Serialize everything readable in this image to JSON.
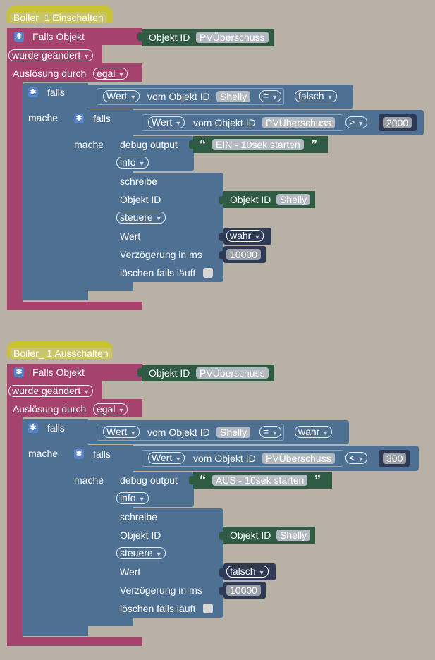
{
  "groups": [
    {
      "name": "Boiler_1 Einschalten",
      "trigger_label": "Falls Objekt",
      "trigger_object_prefix": "Objekt ID",
      "trigger_object_id": "PVÜberschuss",
      "change_option": "wurde geändert",
      "trigger_by_label": "Auslösung durch",
      "trigger_by_value": "egal",
      "outer_if": {
        "falls_label": "falls",
        "mache_label": "mache",
        "left": "Wert",
        "from_object_label": "vom Objekt ID",
        "object": "Shelly",
        "operator": "=",
        "right": "falsch"
      },
      "inner_if": {
        "falls_label": "falls",
        "mache_label": "mache",
        "left": "Wert",
        "from_object_label": "vom Objekt ID",
        "object": "PVÜberschuss",
        "operator": ">",
        "threshold": "2000"
      },
      "debug": {
        "label": "debug output",
        "message": "EIN - 10sek starten",
        "level": "info"
      },
      "write": {
        "label": "schreibe",
        "object_label": "Objekt ID",
        "object_prefix": "Objekt ID",
        "object": "Shelly",
        "mode": "steuere",
        "value_label": "Wert",
        "value": "wahr",
        "delay_label": "Verzögerung in ms",
        "delay": "10000",
        "clear_label": "löschen falls läuft"
      }
    },
    {
      "name": "Boiler_ 1 Ausschalten",
      "trigger_label": "Falls Objekt",
      "trigger_object_prefix": "Objekt ID",
      "trigger_object_id": "PVÜberschuss",
      "change_option": "wurde geändert",
      "trigger_by_label": "Auslösung durch",
      "trigger_by_value": "egal",
      "outer_if": {
        "falls_label": "falls",
        "mache_label": "mache",
        "left": "Wert",
        "from_object_label": "vom Objekt ID",
        "object": "Shelly",
        "operator": "=",
        "right": "wahr"
      },
      "inner_if": {
        "falls_label": "falls",
        "mache_label": "mache",
        "left": "Wert",
        "from_object_label": "vom Objekt ID",
        "object": "PVÜberschuss",
        "operator": "<",
        "threshold": "300"
      },
      "debug": {
        "label": "debug output",
        "message": "AUS - 10sek starten",
        "level": "info"
      },
      "write": {
        "label": "schreibe",
        "object_label": "Objekt ID",
        "object_prefix": "Objekt ID",
        "object": "Shelly",
        "mode": "steuere",
        "value_label": "Wert",
        "value": "falsch",
        "delay_label": "Verzögerung in ms",
        "delay": "10000",
        "clear_label": "löschen falls läuft"
      }
    }
  ],
  "icons": {
    "gear": "gear-icon",
    "dropdown": "dropdown-arrow-icon",
    "quote": "quote-icon",
    "checkbox": "checkbox-icon"
  },
  "colors": {
    "workspace": "#b7b1a6",
    "event_block": "#a5436e",
    "logic_block": "#4e7193",
    "object_block": "#2f5b42",
    "value_block": "#2f3a57",
    "hat_block": "#c9c232"
  }
}
